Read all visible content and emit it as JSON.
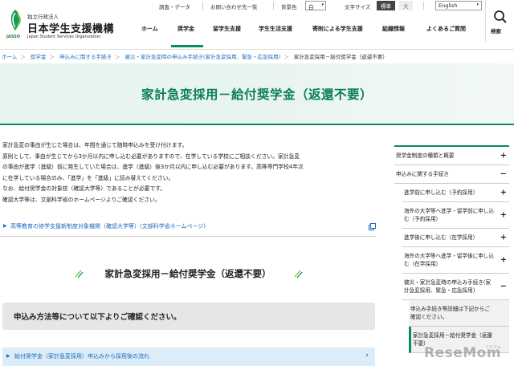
{
  "header": {
    "logo_small": "独立行政法人",
    "logo_name": "日本学生支援機構",
    "logo_en": "Japan Student Services Organization",
    "logo_jasso": "JASSO",
    "utility": {
      "survey": "調査・データ",
      "contact": "お問い合わせ先一覧",
      "bgcolor_label": "背景色",
      "bgcolor_value": "白",
      "font_label": "文字サイズ",
      "font_standard": "標準",
      "font_large": "大",
      "language": "English"
    },
    "gnav": [
      "ホーム",
      "奨学金",
      "留学生支援",
      "学生生活支援",
      "寄附による学生支援",
      "組織情報",
      "よくあるご質問"
    ],
    "search_label": "検索",
    "accent": "#0a8d5a"
  },
  "breadcrumb": {
    "items": [
      "ホーム",
      "奨学金",
      "申込みに関する手続き",
      "被災・家計急変時の申込み手続き(家計急変採用、緊急・応急採用)"
    ],
    "current": "家計急変採用－給付奨学金（返還不要）"
  },
  "title": "家計急変採用－給付奨学金（返還不要）",
  "main": {
    "paragraphs": [
      "家計急変の事由が生じた場合は、年間を通じて随時申込みを受け付けます。",
      "原則として、事由が生じてから3か月以内に申し込む必要がありますので、在学している学校にご相談ください。家計急変",
      "の事由が進学（進級）前に発生していた場合は、進学（進級）後3か月以内に申し込む必要があります。高等専門学校4年次",
      "に在学している場合のみ、「進学」を「進級」に読み替えてください。",
      "なお、給付奨学金の対象校（確認大学等）であることが必要です。",
      "確認大学等は、文部科学省のホームページよりご確認ください。"
    ],
    "ext_link": "高等教育の修学支援新制度対象機関（確認大学等）(文部科学省ホームページ)",
    "section_heading": "家計急変採用－給付奨学金（返還不要）",
    "notice": "申込み方法等について以下よりご確認ください。",
    "accordion": "給付奨学金（家計急変採用）申込みから採用後の流れ"
  },
  "sidebar": {
    "items": [
      {
        "label": "奨学金制度の種類と概要",
        "sign": "+"
      },
      {
        "label": "申込みに関する手続き",
        "sign": "−"
      },
      {
        "label": "進学前に申し込む（予約採用）",
        "sign": "+"
      },
      {
        "label": "海外の大学等へ進学・留学前に申し込む（予約採用）",
        "sign": "+"
      },
      {
        "label": "進学後に申し込む（在学採用）",
        "sign": "+"
      },
      {
        "label": "海外の大学等へ進学・留学後に申し込む（在学採用）",
        "sign": "+"
      },
      {
        "label": "被災・家計急変時の申込み手続き(家計急変採用、緊急・応急採用)",
        "sign": "−"
      },
      {
        "label": "申込み手続き等詳細は下記からご確認ください。",
        "sign": ""
      },
      {
        "label": "家計急変採用－給付奨学金（返還不要）",
        "sign": ""
      }
    ]
  },
  "watermark": "ReseMom",
  "watermark_small": "リセマム"
}
